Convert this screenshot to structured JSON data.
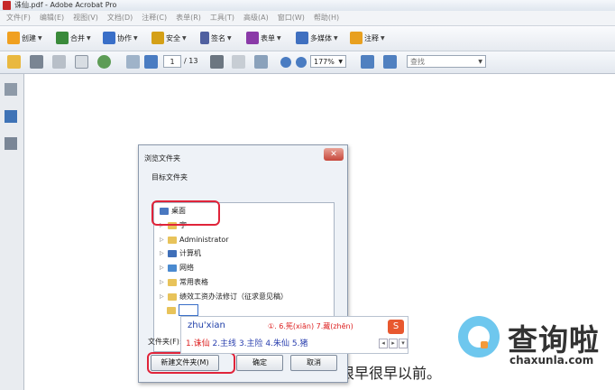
{
  "app": {
    "title": "诛仙.pdf - Adobe Acrobat Pro"
  },
  "menu": [
    "文件(F)",
    "编辑(E)",
    "视图(V)",
    "文档(D)",
    "注释(C)",
    "表单(R)",
    "工具(T)",
    "高级(A)",
    "窗口(W)",
    "帮助(H)"
  ],
  "task_toolbar": [
    {
      "label": "创建",
      "icon": "create-icon",
      "color": "#f0a020"
    },
    {
      "label": "合并",
      "icon": "combine-icon",
      "color": "#3a8a3a"
    },
    {
      "label": "协作",
      "icon": "collaborate-icon",
      "color": "#3a6fc8"
    },
    {
      "label": "安全",
      "icon": "lock-icon",
      "color": "#d4a017"
    },
    {
      "label": "签名",
      "icon": "pen-icon",
      "color": "#5060a0"
    },
    {
      "label": "表单",
      "icon": "form-icon",
      "color": "#8a3aa8"
    },
    {
      "label": "多媒体",
      "icon": "multimedia-icon",
      "color": "#4070c0"
    },
    {
      "label": "注释",
      "icon": "comment-icon",
      "color": "#e8a020"
    }
  ],
  "nav": {
    "page": "1",
    "total": "/ 13",
    "zoom": "177%",
    "find_placeholder": "查找"
  },
  "dialog": {
    "title": "浏览文件夹",
    "label": "目标文件夹",
    "close": "✕",
    "tree": [
      {
        "label": "桌面",
        "level": 0,
        "arrow": ""
      },
      {
        "label": "宇",
        "level": 1,
        "arrow": "▷"
      },
      {
        "label": "Administrator",
        "level": 1,
        "arrow": "▷"
      },
      {
        "label": "计算机",
        "level": 1,
        "arrow": "▷"
      },
      {
        "label": "网络",
        "level": 1,
        "arrow": "▷"
      },
      {
        "label": "常用表格",
        "level": 1,
        "arrow": "▷"
      },
      {
        "label": "绩效工资办法修订（征求意见稿）",
        "level": 1,
        "arrow": "▷"
      }
    ],
    "folder_label": "文件夹(F):",
    "buttons": {
      "new_folder": "新建文件夹(M)",
      "ok": "确定",
      "cancel": "取消"
    }
  },
  "ime": {
    "pinyin": "zhu'xian",
    "extra": "①. 6.筅(xiān) 7.藏(zhēn)",
    "candidates": [
      "1.诛仙",
      "2.主线",
      "3.主险",
      "4.朱仙",
      "5.猪"
    ],
    "logo": "S"
  },
  "document": {
    "text": "很早很早以前。"
  },
  "watermark": {
    "brand": "查询啦",
    "domain": "chaxunla.com"
  },
  "colors": {
    "highlight": "#e0243a",
    "accent": "#3a6fc8"
  }
}
